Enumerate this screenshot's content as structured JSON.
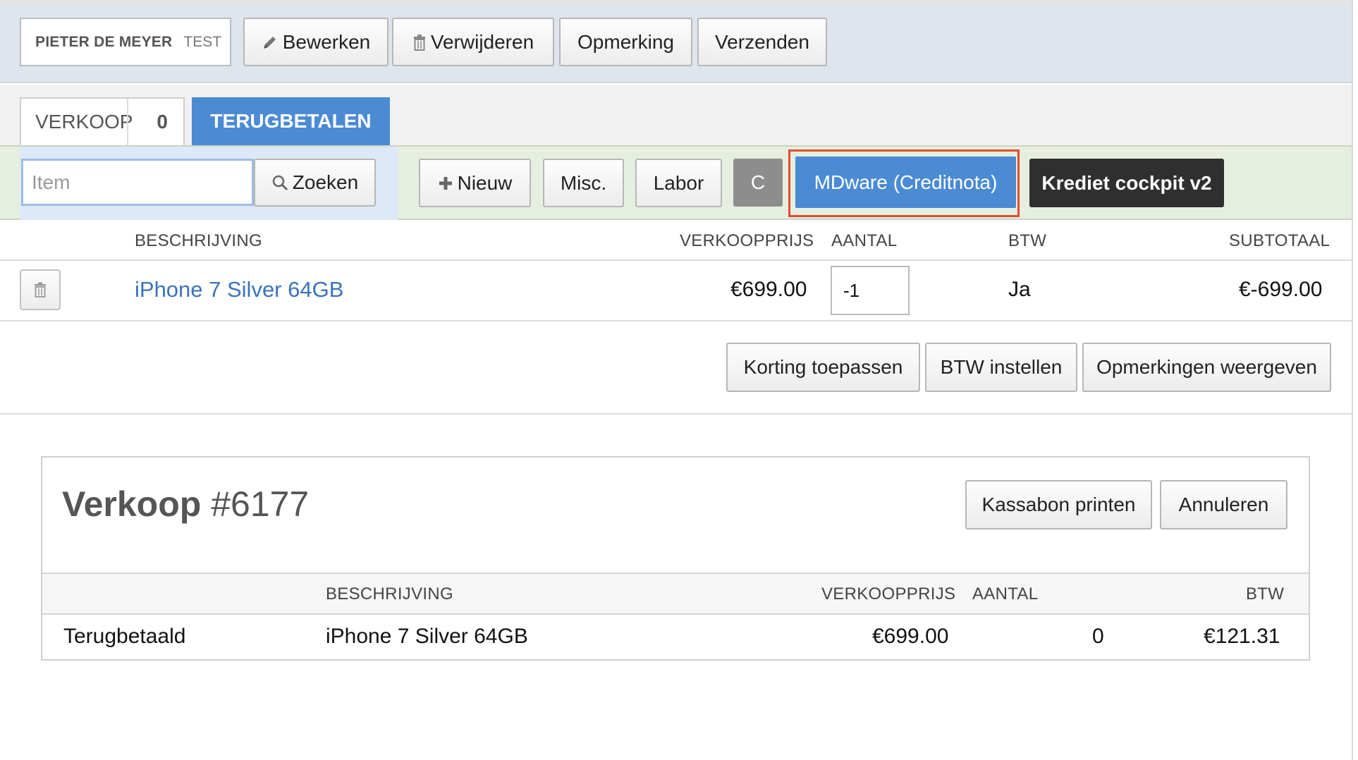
{
  "header": {
    "customer_name": "PIETER DE MEYER",
    "customer_tag": "TEST",
    "buttons": {
      "edit": "Bewerken",
      "delete": "Verwijderen",
      "remark": "Opmerking",
      "send": "Verzenden"
    }
  },
  "tabs": {
    "sale_label": "VERKOOP",
    "sale_count": "0",
    "refund_label": "TERUGBETALEN"
  },
  "toolbar": {
    "search_placeholder": "Item",
    "search_button": "Zoeken",
    "new_button": "Nieuw",
    "misc_button": "Misc.",
    "labor_button": "Labor",
    "c_button": "C",
    "mdware_button": "MDware (Creditnota)",
    "krediet_button": "Krediet cockpit v2"
  },
  "table": {
    "columns": [
      "BESCHRIJVING",
      "VERKOOPPRIJS",
      "AANTAL",
      "BTW",
      "SUBTOTAAL"
    ],
    "row": {
      "description": "iPhone 7 Silver 64GB",
      "price": "€699.00",
      "quantity": "-1",
      "vat": "Ja",
      "subtotal": "€-699.00"
    }
  },
  "actions": {
    "discount": "Korting toepassen",
    "vat_setup": "BTW instellen",
    "show_remarks": "Opmerkingen weergeven"
  },
  "sale_panel": {
    "title_prefix": "Verkoop",
    "title_number": "#6177",
    "print_button": "Kassabon printen",
    "cancel_button": "Annuleren",
    "columns": [
      "BESCHRIJVING",
      "VERKOOPPRIJS",
      "AANTAL",
      "BTW"
    ],
    "row": {
      "status": "Terugbetaald",
      "description": "iPhone 7 Silver 64GB",
      "price": "€699.00",
      "quantity": "0",
      "vat": "€121.31"
    }
  },
  "colors": {
    "accent_blue": "#4b8bd4",
    "highlight_red": "#e24b30",
    "dark_button": "#2f2f2f",
    "link_blue": "#3a73b9"
  },
  "icons": [
    "pencil-icon",
    "trash-icon",
    "search-icon",
    "plus-icon"
  ]
}
